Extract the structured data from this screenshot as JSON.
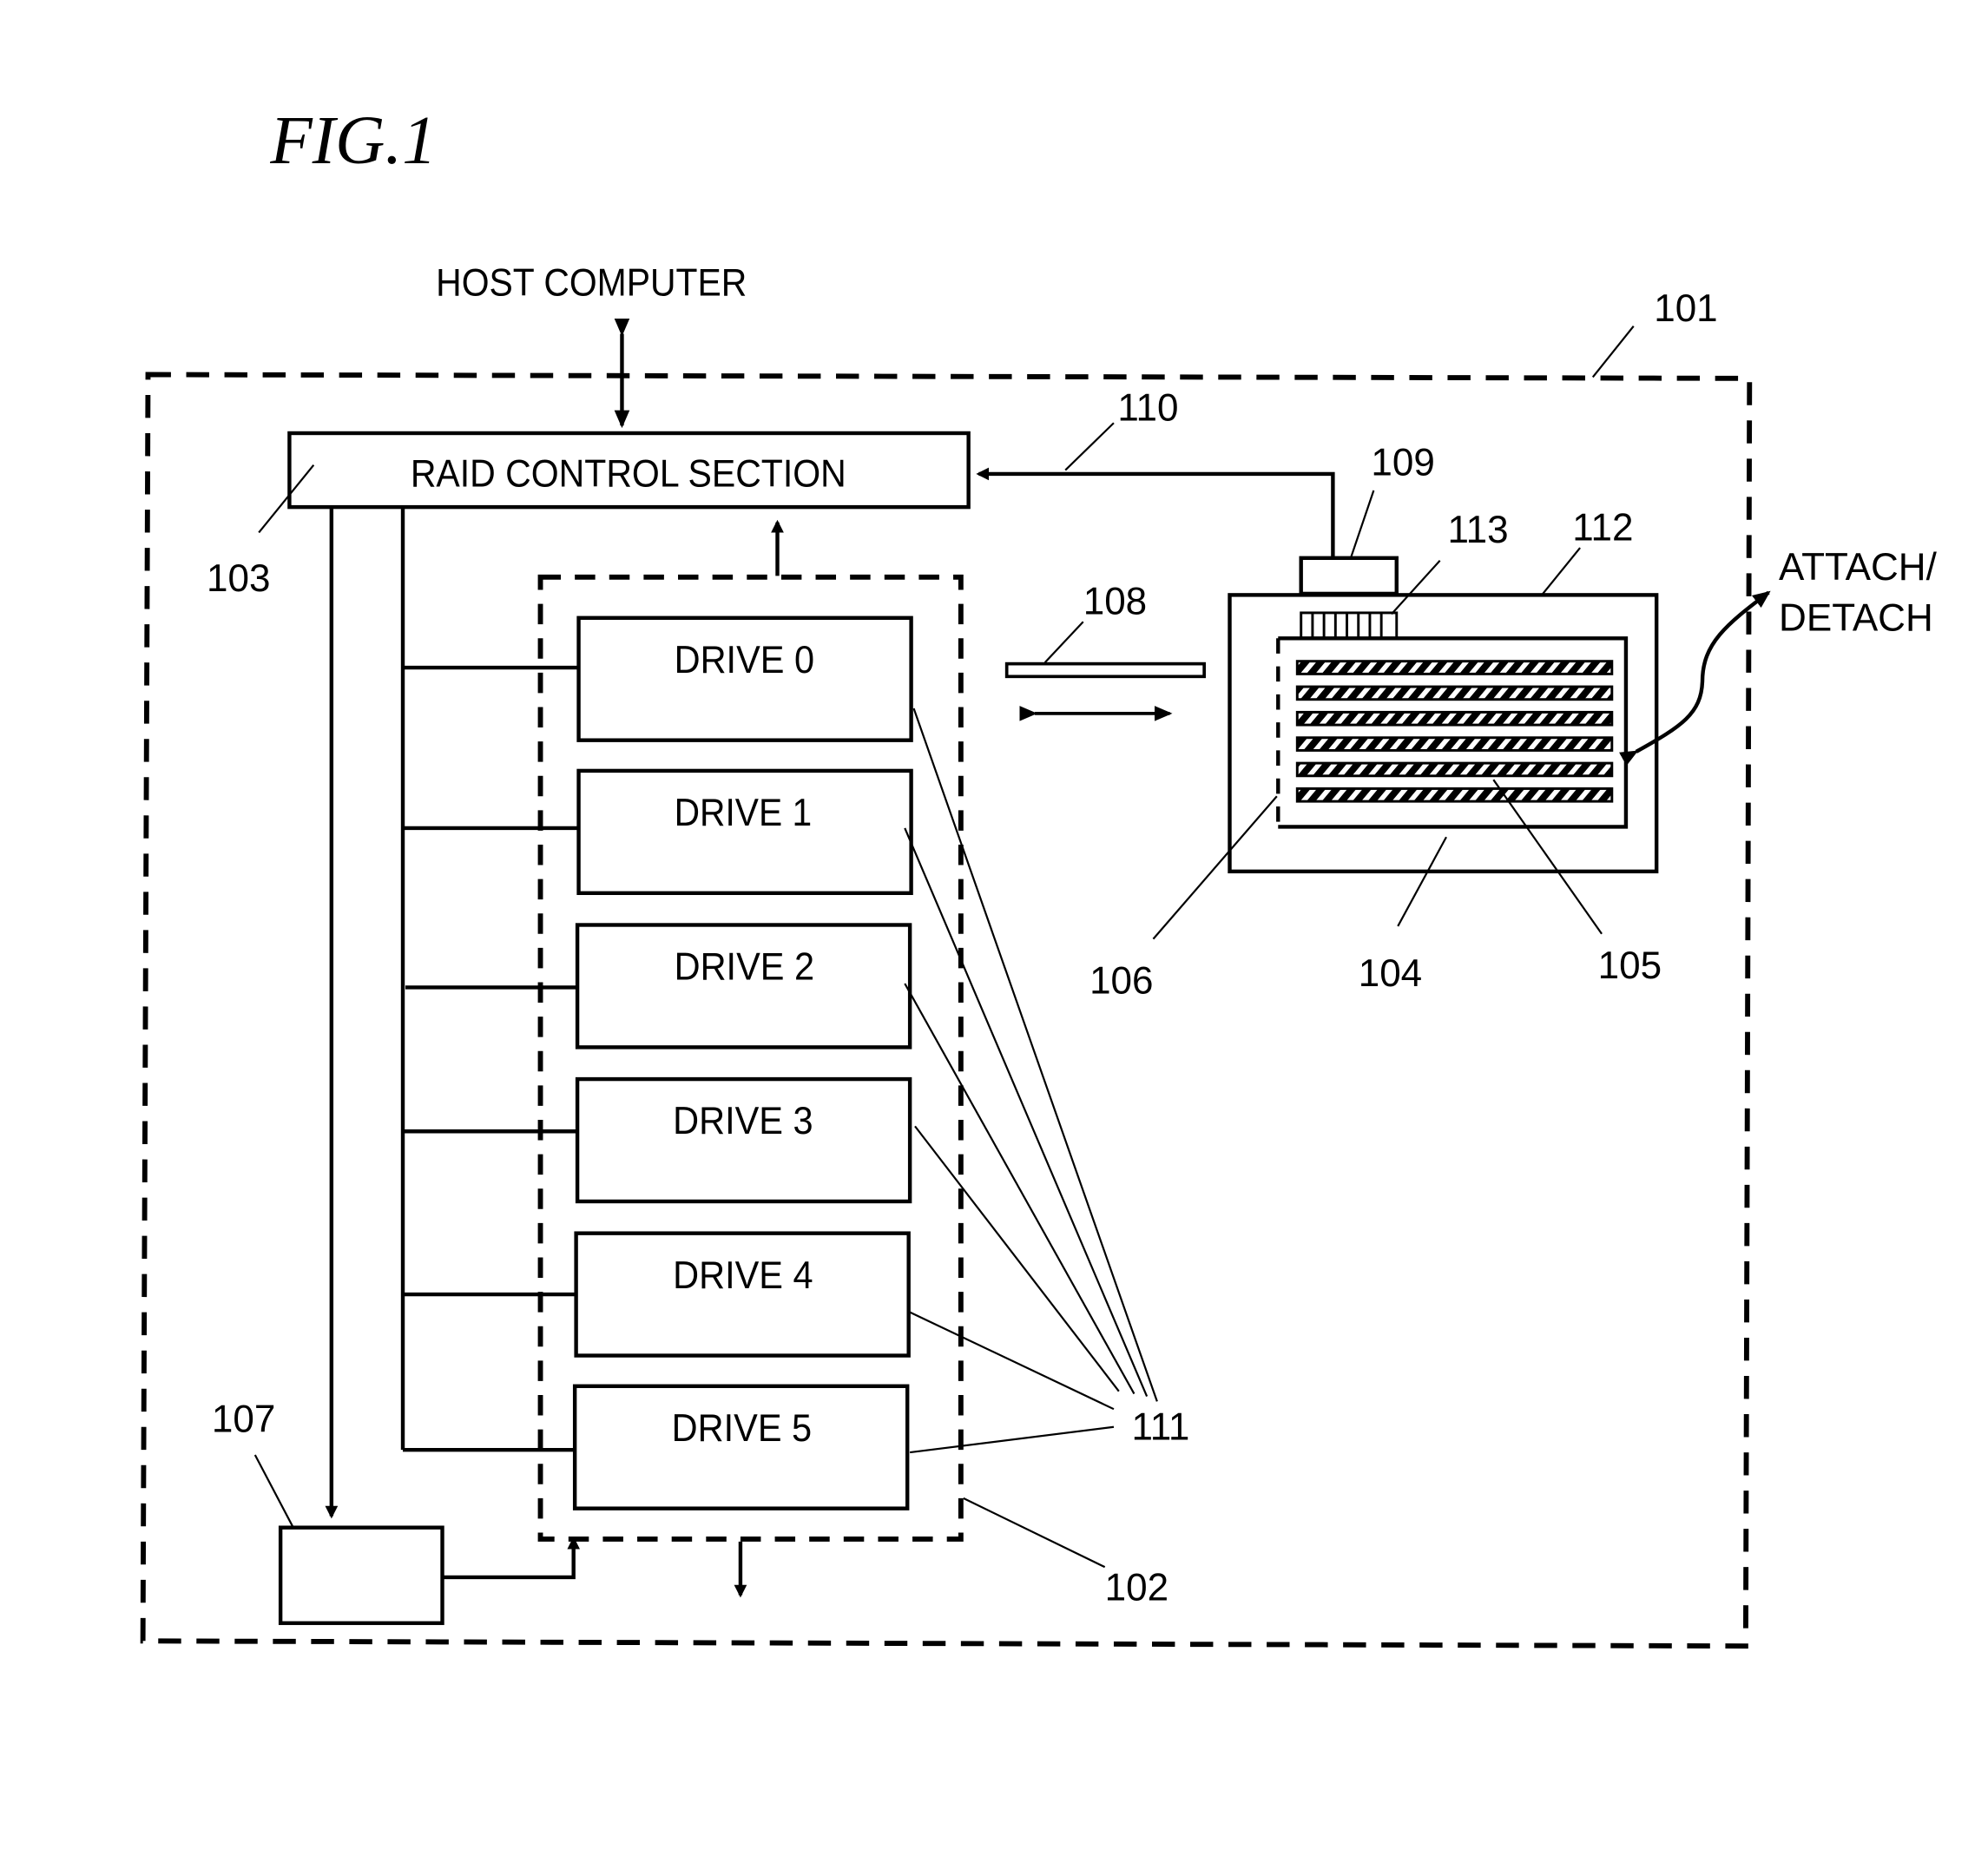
{
  "figure": {
    "title": "FIG.1",
    "host_label": "HOST COMPUTER",
    "raid_label": "RAID CONTROL SECTION",
    "attach_label_1": "ATTACH/",
    "attach_label_2": "DETACH",
    "drives": [
      {
        "label": "DRIVE 0"
      },
      {
        "label": "DRIVE 1"
      },
      {
        "label": "DRIVE 2"
      },
      {
        "label": "DRIVE 3"
      },
      {
        "label": "DRIVE 4"
      },
      {
        "label": "DRIVE 5"
      }
    ],
    "refs": {
      "r101": "101",
      "r102": "102",
      "r103": "103",
      "r104": "104",
      "r105": "105",
      "r106": "106",
      "r107": "107",
      "r108": "108",
      "r109": "109",
      "r110": "110",
      "r111": "111",
      "r112": "112",
      "r113": "113"
    }
  }
}
